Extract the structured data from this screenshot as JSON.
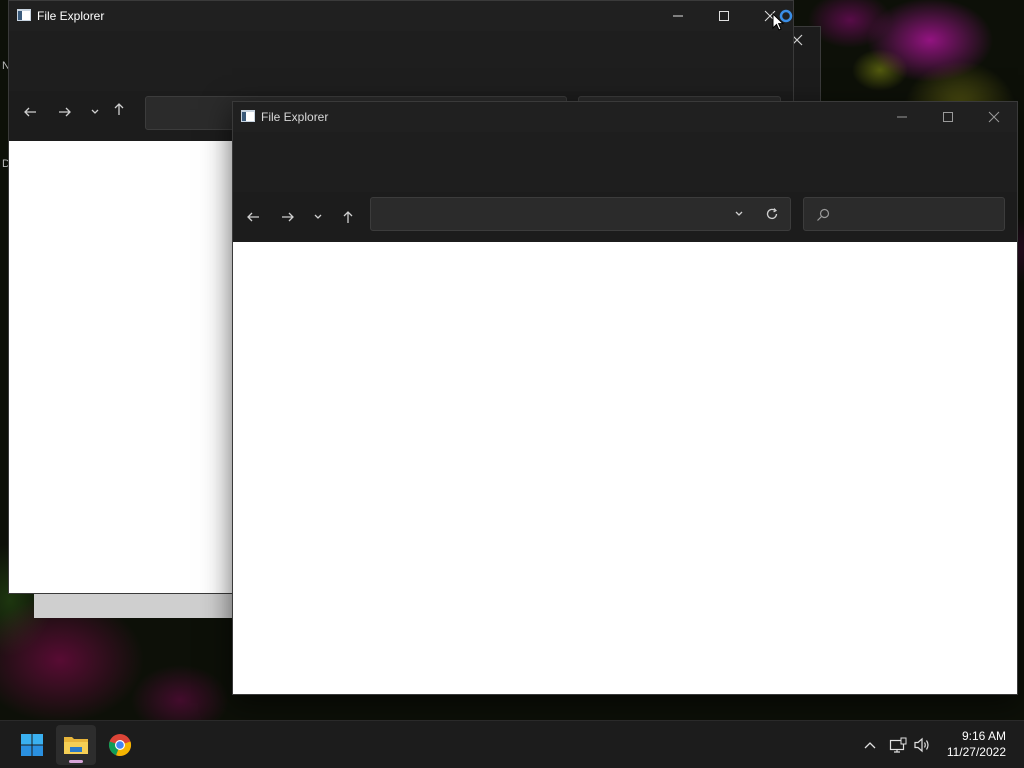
{
  "windows": [
    {
      "id": "back",
      "title": "File Explorer",
      "address_value": "",
      "search_value": ""
    },
    {
      "id": "front",
      "title": "File Explorer",
      "address_value": "",
      "search_value": ""
    }
  ],
  "desktop": {
    "edge_letter_top": "N",
    "edge_letter_mid": "D"
  },
  "taskbar": {
    "apps": [
      {
        "name": "start",
        "icon": "windows-start-icon",
        "active": false
      },
      {
        "name": "file-explorer",
        "icon": "folder-icon",
        "active": true
      },
      {
        "name": "chrome",
        "icon": "chrome-icon",
        "active": false
      }
    ],
    "tray": {
      "overflow_icon": "chevron-up-icon",
      "network_icon": "network-icon",
      "volume_icon": "volume-icon"
    },
    "clock": {
      "time": "9:16 AM",
      "date": "11/27/2022"
    }
  },
  "colors": {
    "accent_blue": "#3a8ee6",
    "titlebar_bg": "#202020",
    "content_bg": "#ffffff"
  }
}
